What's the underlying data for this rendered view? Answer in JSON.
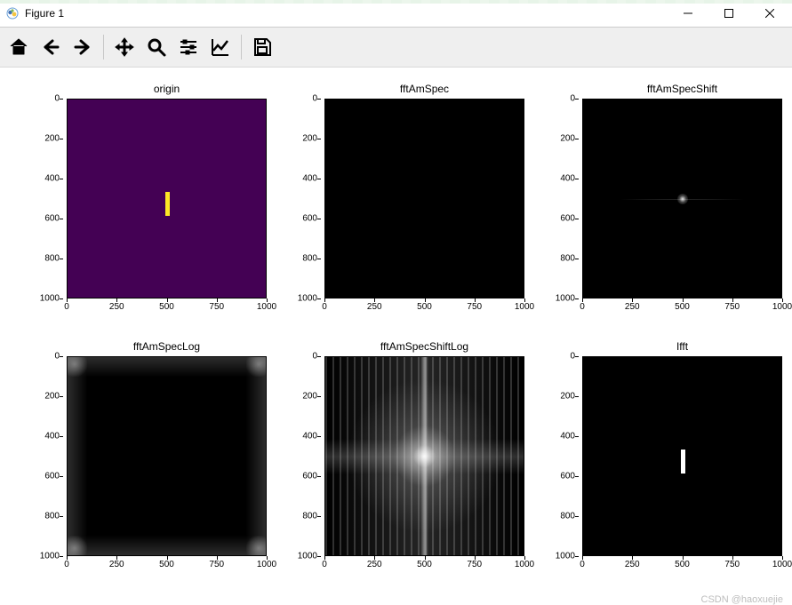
{
  "window": {
    "title": "Figure 1"
  },
  "toolbar": {
    "home": "home-icon",
    "back": "back-icon",
    "forward": "forward-icon",
    "pan": "pan-icon",
    "zoom": "zoom-icon",
    "subplots": "sliders-icon",
    "axes": "axes-icon",
    "save": "save-icon"
  },
  "watermark": "CSDN @haoxuejie",
  "ticks": {
    "x": [
      "0",
      "250",
      "500",
      "750",
      "1000"
    ],
    "y": [
      "0",
      "200",
      "400",
      "600",
      "800",
      "1000"
    ]
  },
  "subplots": [
    {
      "id": "origin",
      "title": "origin",
      "row": 0,
      "col": 0,
      "kind": "origin"
    },
    {
      "id": "fftAmSpec",
      "title": "fftAmSpec",
      "row": 0,
      "col": 1,
      "kind": "black"
    },
    {
      "id": "fftAmSpecShift",
      "title": "fftAmSpecShift",
      "row": 0,
      "col": 2,
      "kind": "shift_faint"
    },
    {
      "id": "fftAmSpecLog",
      "title": "fftAmSpecLog",
      "row": 1,
      "col": 0,
      "kind": "log_noshift"
    },
    {
      "id": "fftAmSpecShiftLog",
      "title": "fftAmSpecShiftLog",
      "row": 1,
      "col": 1,
      "kind": "log_shift"
    },
    {
      "id": "Ifft",
      "title": "Ifft",
      "row": 1,
      "col": 2,
      "kind": "ifft"
    }
  ],
  "chart_data": [
    {
      "type": "heatmap",
      "title": "origin",
      "xlabel": "",
      "ylabel": "",
      "xlim": [
        0,
        1000
      ],
      "ylim": [
        0,
        1000
      ],
      "description": "Viridis purple field with a single yellow vertical bar.",
      "bar": {
        "x_center": 500,
        "y_top": 460,
        "y_bottom": 580,
        "width": 20,
        "color": "#fde725"
      },
      "cmap": "viridis"
    },
    {
      "type": "heatmap",
      "title": "fftAmSpec",
      "xlabel": "",
      "ylabel": "",
      "xlim": [
        0,
        1000
      ],
      "ylim": [
        0,
        1000
      ],
      "description": "Amplitude spectrum without shift; visually near-black (energy at corners below 8-bit display threshold).",
      "cmap": "gray"
    },
    {
      "type": "heatmap",
      "title": "fftAmSpecShift",
      "xlabel": "",
      "ylabel": "",
      "xlim": [
        0,
        1000
      ],
      "ylim": [
        0,
        1000
      ],
      "description": "Shifted amplitude spectrum; faint bright point at center (≈500,500) with weak horizontal streak.",
      "peak": {
        "x": 500,
        "y": 500
      },
      "cmap": "gray"
    },
    {
      "type": "heatmap",
      "title": "fftAmSpecLog",
      "xlabel": "",
      "ylabel": "",
      "xlim": [
        0,
        1000
      ],
      "ylim": [
        0,
        1000
      ],
      "description": "Log amplitude spectrum without shift; faint energy visible at the four corners and along the image borders.",
      "cmap": "gray"
    },
    {
      "type": "heatmap",
      "title": "fftAmSpecShiftLog",
      "xlabel": "",
      "ylabel": "",
      "xlim": [
        0,
        1000
      ],
      "ylim": [
        0,
        1000
      ],
      "description": "Log shifted amplitude spectrum; bright cross centered at (≈500,500) with strong horizontal sinc-like streak, weaker vertical glow.",
      "peak": {
        "x": 500,
        "y": 500
      },
      "cmap": "gray"
    },
    {
      "type": "heatmap",
      "title": "Ifft",
      "xlabel": "",
      "ylabel": "",
      "xlim": [
        0,
        1000
      ],
      "ylim": [
        0,
        1000
      ],
      "description": "Inverse FFT reconstruction; white vertical bar at same position as origin on black background.",
      "bar": {
        "x_center": 500,
        "y_top": 460,
        "y_bottom": 580,
        "width": 20,
        "color": "#ffffff"
      },
      "cmap": "gray"
    }
  ]
}
